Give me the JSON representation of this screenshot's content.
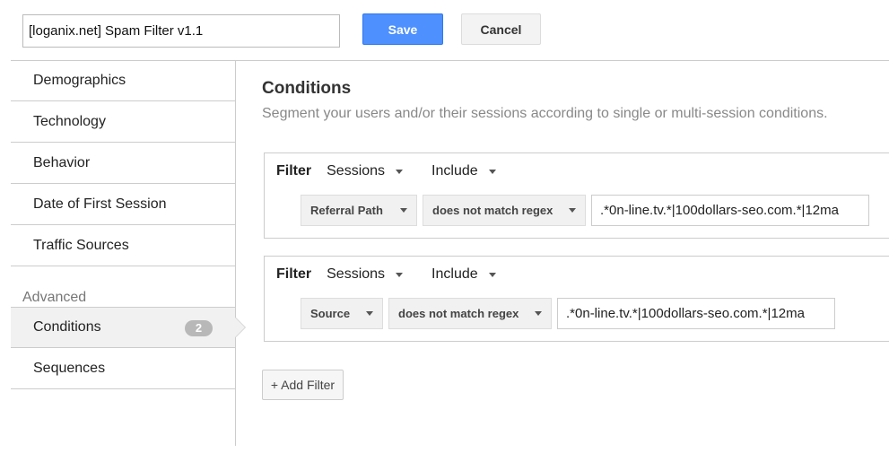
{
  "header": {
    "segment_name": "[loganix.net] Spam Filter v1.1",
    "save_label": "Save",
    "cancel_label": "Cancel"
  },
  "sidebar": {
    "items": [
      {
        "label": "Demographics"
      },
      {
        "label": "Technology"
      },
      {
        "label": "Behavior"
      },
      {
        "label": "Date of First Session"
      },
      {
        "label": "Traffic Sources"
      }
    ],
    "advanced_label": "Advanced",
    "advanced_items": [
      {
        "label": "Conditions",
        "badge": "2"
      },
      {
        "label": "Sequences"
      }
    ]
  },
  "main": {
    "title": "Conditions",
    "subtitle": "Segment your users and/or their sessions according to single or multi-session conditions.",
    "filters": [
      {
        "label": "Filter",
        "scope": "Sessions",
        "mode": "Include",
        "dimension": "Referral Path",
        "operator": "does not match regex",
        "value": ".*0n-line.tv.*|100dollars-seo.com.*|12ma"
      },
      {
        "label": "Filter",
        "scope": "Sessions",
        "mode": "Include",
        "dimension": "Source",
        "operator": "does not match regex",
        "value": ".*0n-line.tv.*|100dollars-seo.com.*|12ma"
      }
    ],
    "add_filter_label": "+ Add Filter"
  },
  "colors": {
    "save": "#4d90fe",
    "badge": "#b8b8b8"
  }
}
